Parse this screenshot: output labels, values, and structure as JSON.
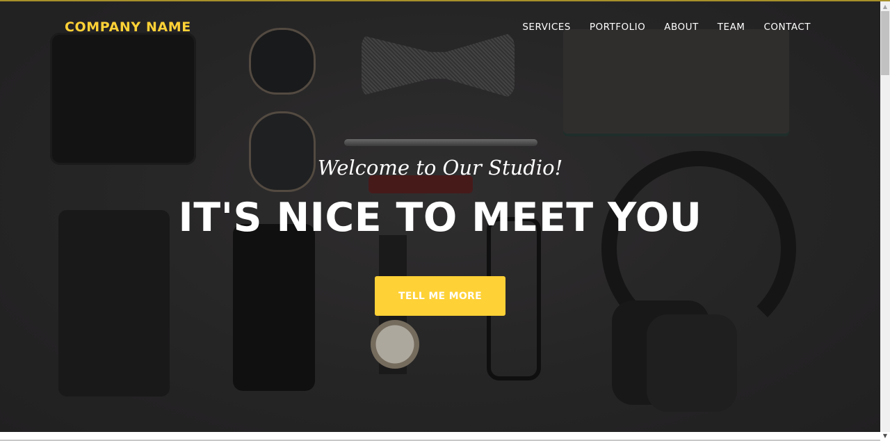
{
  "navbar": {
    "brand": "COMPANY NAME",
    "links": [
      "SERVICES",
      "PORTFOLIO",
      "ABOUT",
      "TEAM",
      "CONTACT"
    ]
  },
  "hero": {
    "subheading": "Welcome to Our Studio!",
    "heading": "IT'S NICE TO MEET YOU",
    "cta_label": "TELL ME MORE"
  },
  "icons": {
    "scroll_up": "▲",
    "scroll_down": "▼"
  },
  "colors": {
    "accent": "#fed136",
    "text": "#ffffff"
  }
}
